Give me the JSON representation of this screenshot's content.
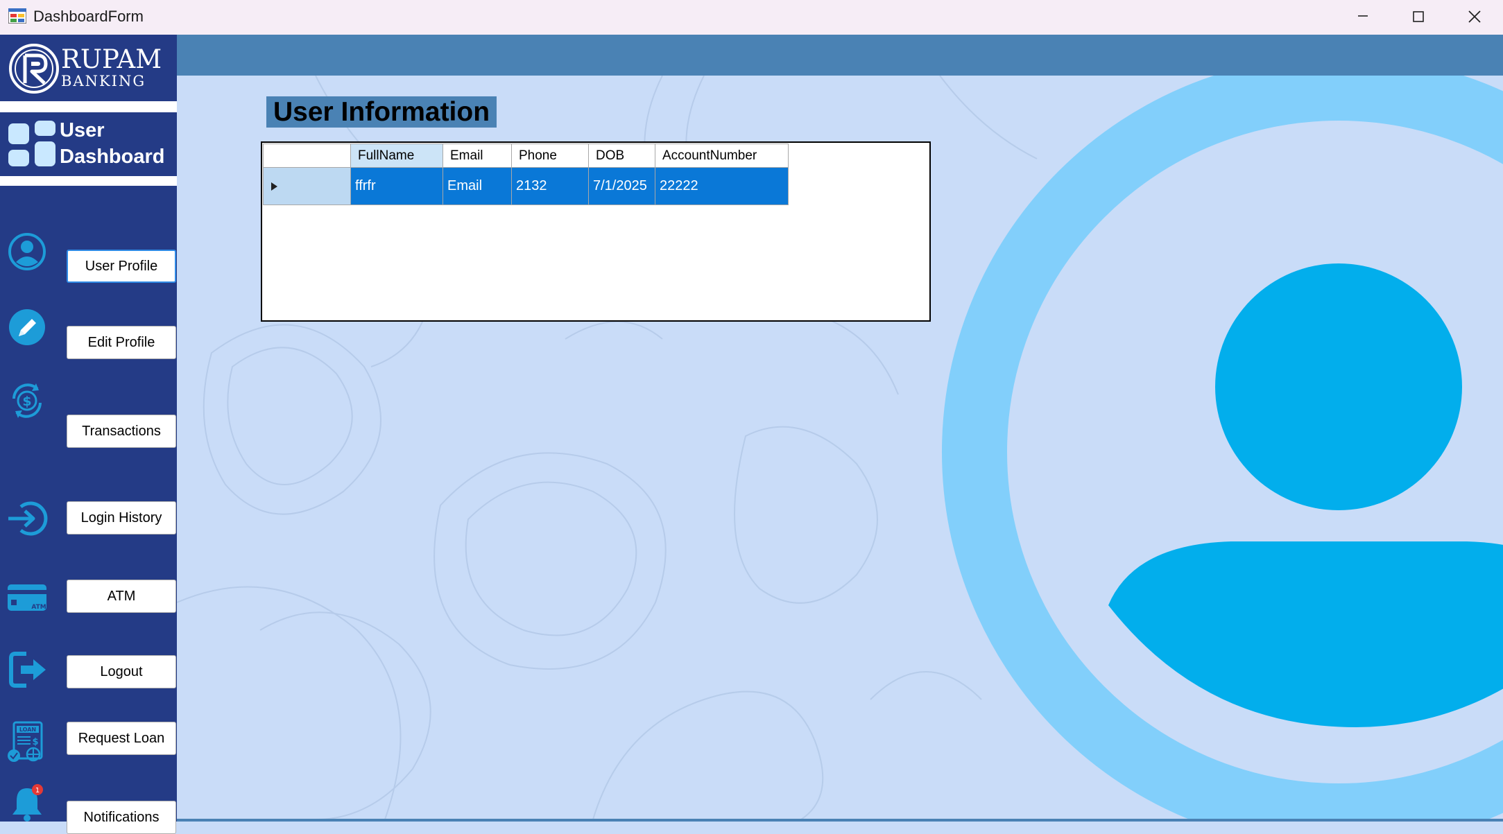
{
  "window": {
    "title": "DashboardForm",
    "controls": [
      "minimize-icon",
      "maximize-icon",
      "close-icon"
    ]
  },
  "brand": {
    "name": "RUPAM",
    "sub": "BANKING"
  },
  "dashboard": {
    "line1": "User",
    "line2": "Dashboard"
  },
  "nav": [
    {
      "label": "User Profile",
      "icon": "user-circle-icon"
    },
    {
      "label": "Edit Profile",
      "icon": "pencil-icon"
    },
    {
      "label": "Transactions",
      "icon": "dollar-cycle-icon"
    },
    {
      "label": "Login History",
      "icon": "login-arrow-icon"
    },
    {
      "label": "ATM",
      "icon": "atm-card-icon"
    },
    {
      "label": "Logout",
      "icon": "logout-icon"
    },
    {
      "label": "Request Loan",
      "icon": "loan-document-icon"
    },
    {
      "label": "Notifications",
      "icon": "bell-icon",
      "badge": "1"
    }
  ],
  "main": {
    "title": "User Information",
    "table": {
      "columns": [
        "FullName",
        "Email",
        "Phone",
        "DOB",
        "AccountNumber"
      ],
      "rows": [
        [
          "ffrfr",
          "Email",
          "2132",
          "7/1/2025",
          "22222"
        ]
      ]
    }
  },
  "colors": {
    "sidebar": "#243b86",
    "topbar": "#4a82b4",
    "background": "#c9dcf8",
    "selection": "#0a78d7",
    "avatar_ring": "#82cffb",
    "avatar_fill": "#02aeec"
  }
}
